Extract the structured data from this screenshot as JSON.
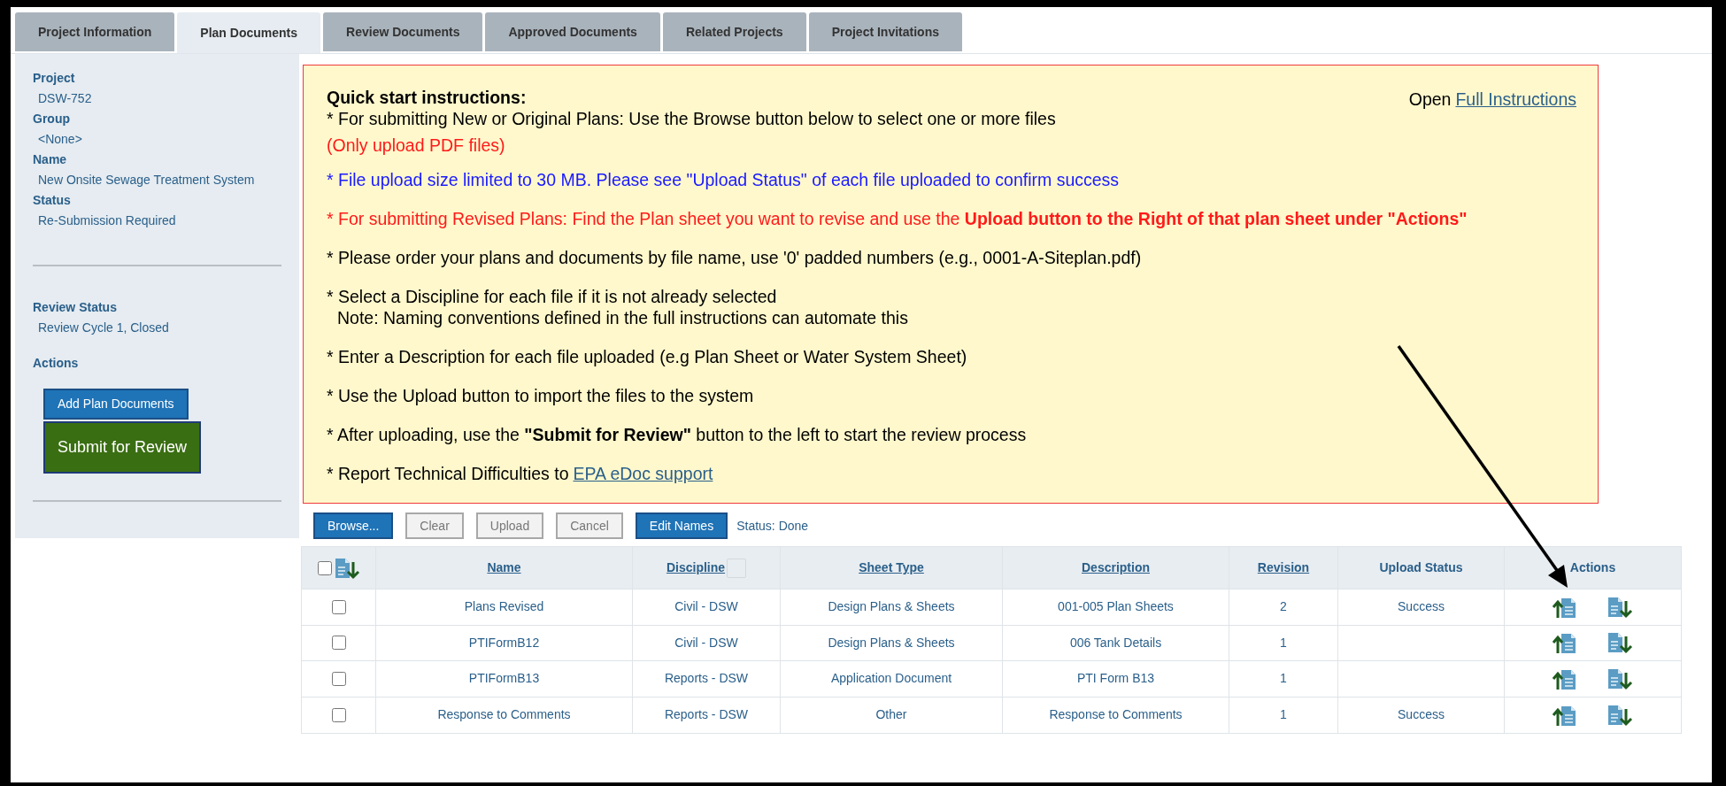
{
  "tabs": [
    {
      "label": "Project Information",
      "selected": false
    },
    {
      "label": "Plan Documents",
      "selected": true
    },
    {
      "label": "Review Documents",
      "selected": false
    },
    {
      "label": "Approved Documents",
      "selected": false
    },
    {
      "label": "Related Projects",
      "selected": false
    },
    {
      "label": "Project Invitations",
      "selected": false
    }
  ],
  "sidebar": {
    "fields": [
      {
        "label": "Project",
        "value": "DSW-752"
      },
      {
        "label": "Group",
        "value": "<None>"
      },
      {
        "label": "Name",
        "value": "New Onsite Sewage Treatment System"
      },
      {
        "label": "Status",
        "value": "Re-Submission Required"
      }
    ],
    "review_status": {
      "label": "Review Status",
      "value": "Review Cycle 1, Closed"
    },
    "actions_label": "Actions",
    "buttons": [
      {
        "label": "Add Plan Documents",
        "kind": "primary"
      },
      {
        "label": "Submit for Review",
        "kind": "submit"
      }
    ]
  },
  "instructions": {
    "title": "Quick start instructions:",
    "open_label": "Open",
    "open_link": "Full Instructions",
    "lines": [
      {
        "text": "* For submitting New or Original Plans: Use the Browse button below to select one or more files",
        "note": "(Only upload PDF files)",
        "color": "#000000"
      },
      {
        "text": "* File upload size limited to 30 MB. Please see \"Upload Status\" of each file uploaded to confirm success",
        "color": "#1a1aff"
      },
      {
        "text": "* For submitting Revised Plans: Find the Plan sheet you want to revise and use the **Upload button to the Right of that plan sheet under \"Actions\"**",
        "color": "#ff1a1a"
      },
      {
        "text": "* Please order your plans and documents by file name, use '0' padded numbers (e.g., 0001-A-Siteplan.pdf)",
        "color": "#000000"
      },
      {
        "text": "* Select a Discipline for each file if it is not already selected",
        "note": "Note: Naming conventions defined in the full instructions can automate this",
        "color": "#000000"
      },
      {
        "text": "* Enter a Description for each file uploaded (e.g Plan Sheet or Water System Sheet)",
        "color": "#000000"
      },
      {
        "text": "* Use the Upload button to import the files to the system",
        "color": "#000000"
      },
      {
        "text": "* After uploading, use the **\"Submit for Review\"** button to the left to start the review process",
        "color": "#000000"
      },
      {
        "text": "* Report Technical Difficulties to",
        "link": "EPA eDoc support",
        "color": "#000000"
      }
    ]
  },
  "toolbar": {
    "buttons": [
      {
        "label": "Browse...",
        "disabled": false
      },
      {
        "label": "Clear",
        "disabled": true
      },
      {
        "label": "Upload",
        "disabled": true
      },
      {
        "label": "Cancel",
        "disabled": true
      },
      {
        "label": "Edit Names",
        "disabled": false
      }
    ],
    "status": "Status: Done"
  },
  "table": {
    "header_checked": false,
    "columns": [
      {
        "label": "Name",
        "sortable": true
      },
      {
        "label": "Discipline",
        "sortable": true
      },
      {
        "label": "Sheet Type",
        "sortable": true
      },
      {
        "label": "Description",
        "sortable": true
      },
      {
        "label": "Revision",
        "sortable": true
      },
      {
        "label": "Upload Status",
        "sortable": false
      },
      {
        "label": "Actions",
        "sortable": false
      }
    ],
    "rows": [
      {
        "checked": false,
        "cells": [
          "Plans Revised",
          "Civil - DSW",
          "Design Plans & Sheets",
          "001-005 Plan Sheets",
          "2",
          "Success"
        ]
      },
      {
        "checked": false,
        "cells": [
          "PTIFormB12",
          "Civil - DSW",
          "Design Plans & Sheets",
          "006 Tank Details",
          "1",
          ""
        ]
      },
      {
        "checked": false,
        "cells": [
          "PTIFormB13",
          "Reports - DSW",
          "Application Document",
          "PTI Form B13",
          "1",
          ""
        ]
      },
      {
        "checked": false,
        "cells": [
          "Response to Comments",
          "Reports - DSW",
          "Other",
          "Response to Comments",
          "1",
          "Success"
        ]
      }
    ]
  }
}
